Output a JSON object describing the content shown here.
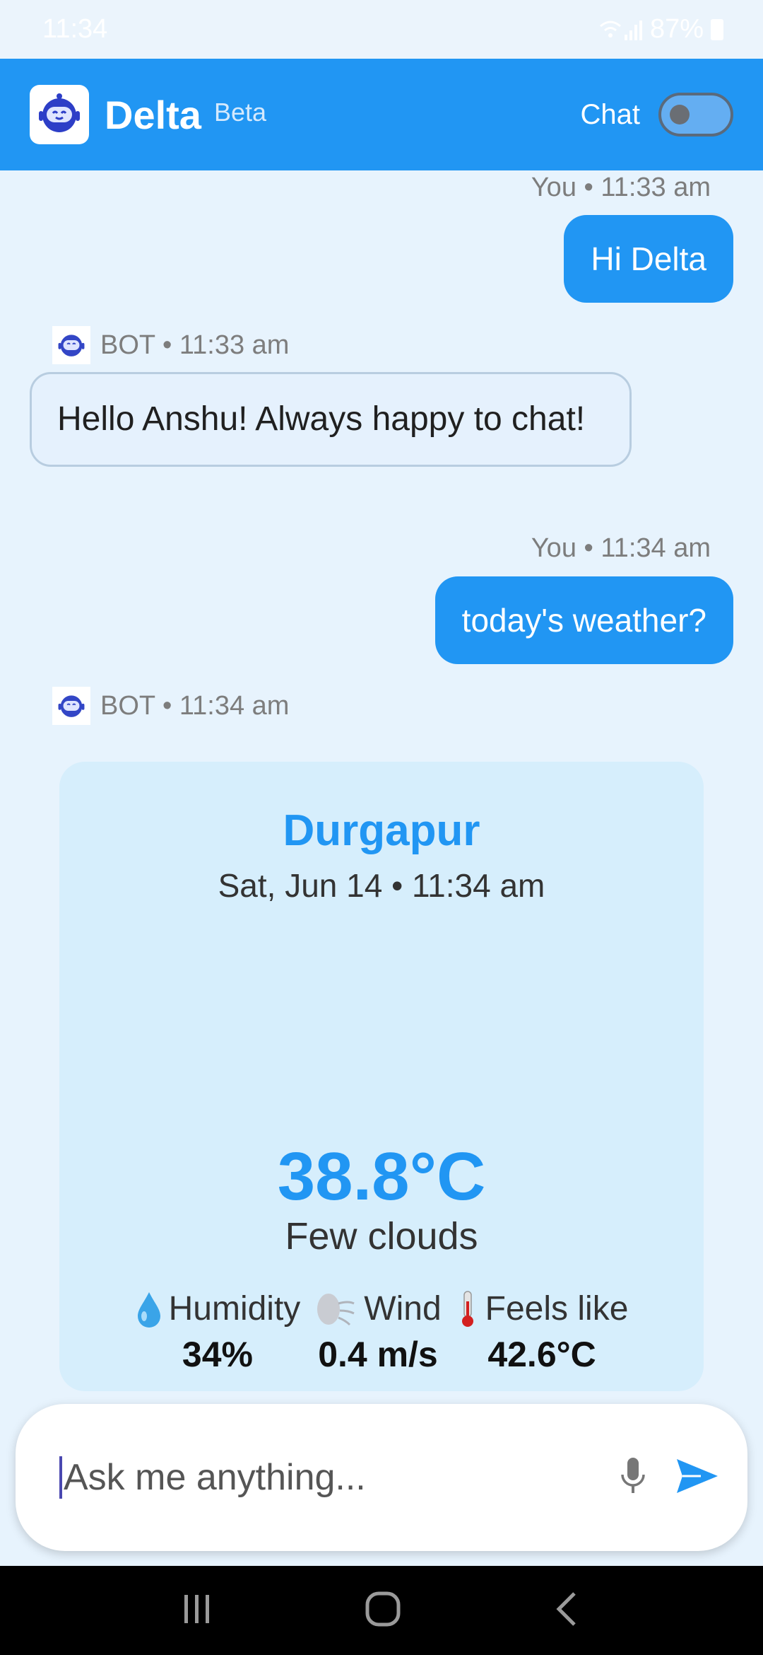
{
  "status_bar": {
    "time": "11:34",
    "battery": "87%"
  },
  "header": {
    "title": "Delta",
    "badge": "Beta",
    "chat_label": "Chat",
    "chat_toggle_on": false
  },
  "messages": [
    {
      "sender": "You",
      "time": "11:33 am",
      "meta": "You • 11:33 am",
      "text": "Hi Delta"
    },
    {
      "sender": "BOT",
      "time": "11:33 am",
      "meta": "BOT • 11:33 am",
      "text": "Hello Anshu! Always happy to chat!"
    },
    {
      "sender": "You",
      "time": "11:34 am",
      "meta": "You • 11:34 am",
      "text": "today's weather?"
    },
    {
      "sender": "BOT",
      "time": "11:34 am",
      "meta": "BOT • 11:34 am"
    }
  ],
  "weather": {
    "city": "Durgapur",
    "datetime": "Sat, Jun 14 • 11:34 am",
    "temperature": "38.8°C",
    "condition": "Few clouds",
    "stats": [
      {
        "icon": "droplet-icon",
        "label": "Humidity",
        "value": "34%"
      },
      {
        "icon": "wind-face-icon",
        "label": "Wind",
        "value": "0.4 m/s"
      },
      {
        "icon": "thermometer-icon",
        "label": "Feels like",
        "value": "42.6°C"
      }
    ]
  },
  "input": {
    "placeholder": "Ask me anything..."
  },
  "colors": {
    "accent": "#2196f3",
    "background": "#e7f3fd",
    "card": "#d6eefc"
  }
}
